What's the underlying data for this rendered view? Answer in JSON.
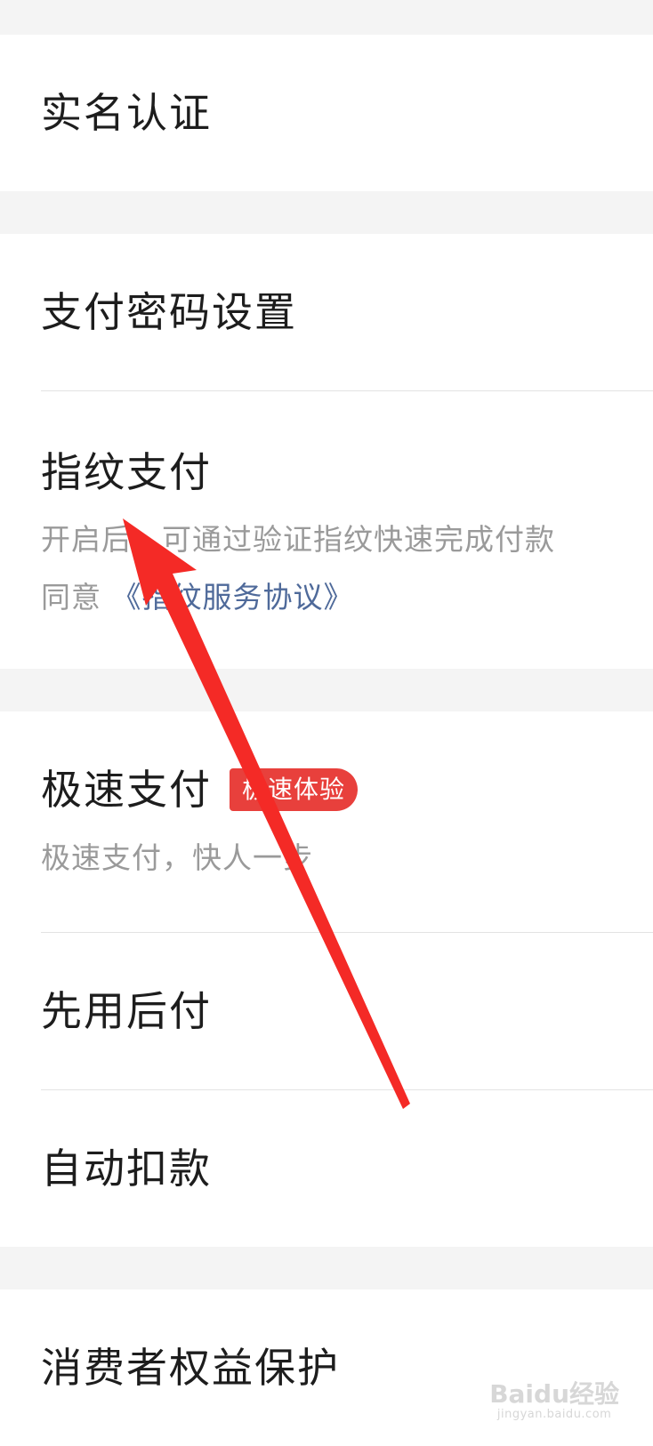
{
  "items": {
    "real_name": "实名认证",
    "payment_password": "支付密码设置",
    "fingerprint": {
      "title": "指纹支付",
      "desc": "开启后，可通过验证指纹快速完成付款",
      "agree_prefix": "同意",
      "agree_link": "《指纹服务协议》"
    },
    "speed_pay": {
      "title": "极速支付",
      "badge": "极速体验",
      "desc": "极速支付，快人一步"
    },
    "pay_later": "先用后付",
    "auto_debit": "自动扣款",
    "consumer_protection": "消费者权益保护"
  },
  "watermark": {
    "brand": "Baidu经验",
    "url": "jingyan.baidu.com"
  },
  "colors": {
    "background": "#f4f4f4",
    "card": "#ffffff",
    "text": "#1d1d1d",
    "subtext": "#9a9a9a",
    "link": "#4f6a9a",
    "badge": "#e8403c",
    "arrow": "#f42a26"
  }
}
